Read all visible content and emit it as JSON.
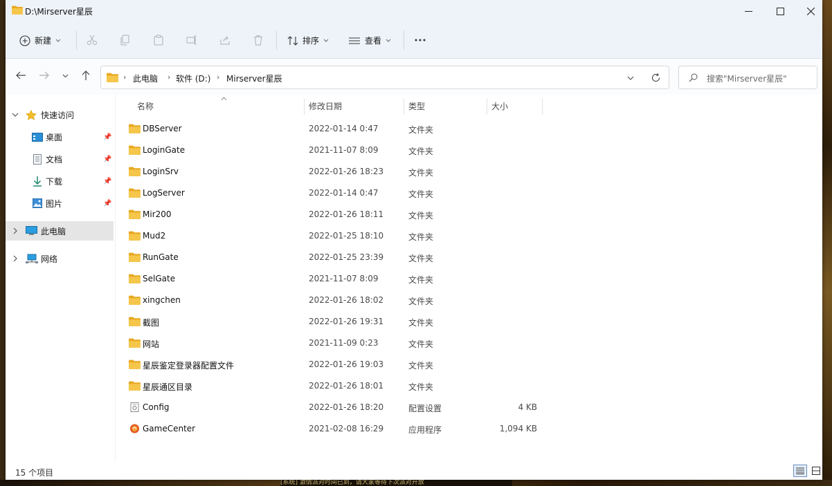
{
  "window": {
    "title": "D:\\Mirserver星辰"
  },
  "toolbar": {
    "new_label": "新建",
    "sort_label": "排序",
    "view_label": "查看"
  },
  "address": {
    "crumbs": [
      "此电脑",
      "软件 (D:)",
      "Mirserver星辰"
    ]
  },
  "search": {
    "placeholder": "搜索\"Mirserver星辰\""
  },
  "sidebar": {
    "quick_access": "快速访问",
    "items": [
      {
        "label": "桌面",
        "icon": "desktop-icon"
      },
      {
        "label": "文档",
        "icon": "document-icon"
      },
      {
        "label": "下载",
        "icon": "download-icon"
      },
      {
        "label": "图片",
        "icon": "picture-icon"
      }
    ],
    "this_pc": "此电脑",
    "network": "网络"
  },
  "columns": {
    "name": "名称",
    "date": "修改日期",
    "type": "类型",
    "size": "大小"
  },
  "files": [
    {
      "name": "DBServer",
      "date": "2022-01-14 0:47",
      "type": "文件夹",
      "size": "",
      "icon": "folder-icon"
    },
    {
      "name": "LoginGate",
      "date": "2021-11-07 8:09",
      "type": "文件夹",
      "size": "",
      "icon": "folder-icon"
    },
    {
      "name": "LoginSrv",
      "date": "2022-01-26 18:23",
      "type": "文件夹",
      "size": "",
      "icon": "folder-icon"
    },
    {
      "name": "LogServer",
      "date": "2022-01-14 0:47",
      "type": "文件夹",
      "size": "",
      "icon": "folder-icon"
    },
    {
      "name": "Mir200",
      "date": "2022-01-26 18:11",
      "type": "文件夹",
      "size": "",
      "icon": "folder-icon"
    },
    {
      "name": "Mud2",
      "date": "2022-01-25 18:10",
      "type": "文件夹",
      "size": "",
      "icon": "folder-icon"
    },
    {
      "name": "RunGate",
      "date": "2022-01-25 23:39",
      "type": "文件夹",
      "size": "",
      "icon": "folder-icon"
    },
    {
      "name": "SelGate",
      "date": "2021-11-07 8:09",
      "type": "文件夹",
      "size": "",
      "icon": "folder-icon"
    },
    {
      "name": "xingchen",
      "date": "2022-01-26 18:02",
      "type": "文件夹",
      "size": "",
      "icon": "folder-icon"
    },
    {
      "name": "截图",
      "date": "2022-01-26 19:31",
      "type": "文件夹",
      "size": "",
      "icon": "folder-icon"
    },
    {
      "name": "网站",
      "date": "2021-11-09 0:23",
      "type": "文件夹",
      "size": "",
      "icon": "folder-icon"
    },
    {
      "name": "星辰鉴定登录器配置文件",
      "date": "2022-01-26 19:03",
      "type": "文件夹",
      "size": "",
      "icon": "folder-icon"
    },
    {
      "name": "星辰通区目录",
      "date": "2022-01-26 18:01",
      "type": "文件夹",
      "size": "",
      "icon": "folder-icon"
    },
    {
      "name": "Config",
      "date": "2022-01-26 18:20",
      "type": "配置设置",
      "size": "4 KB",
      "icon": "config-file-icon"
    },
    {
      "name": "GameCenter",
      "date": "2021-02-08 16:29",
      "type": "应用程序",
      "size": "1,094 KB",
      "icon": "app-icon"
    }
  ],
  "status": {
    "count": "15 个项目"
  },
  "background": {
    "ticker": "[系统] 激情派对时间已到，请大家等待下次派对开放"
  },
  "colors": {
    "folder": "#f5c64a",
    "accent": "#0067c0",
    "titlebar": "#eef3f9"
  }
}
